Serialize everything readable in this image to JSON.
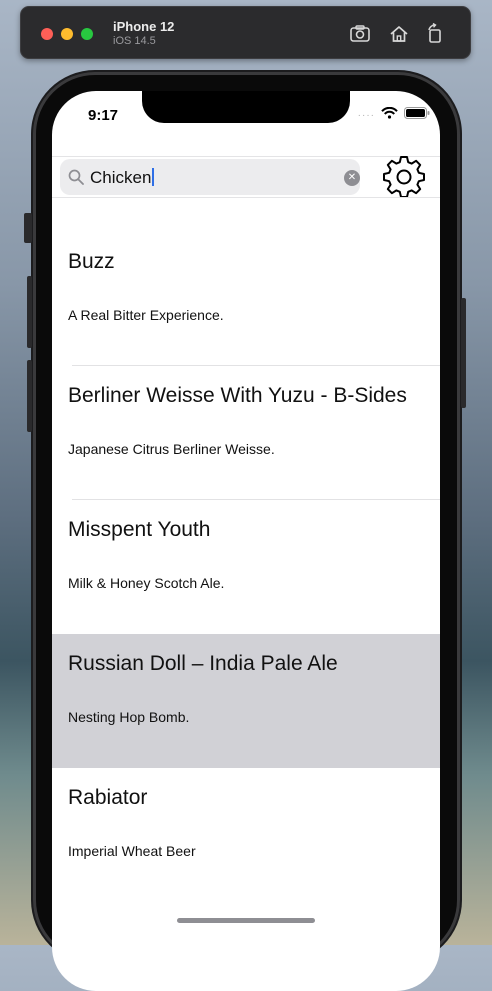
{
  "simulator": {
    "device_name": "iPhone 12",
    "os_version": "iOS 14.5",
    "screenshot_icon": "camera-icon",
    "home_icon": "home-icon",
    "rotate_icon": "rotate-icon"
  },
  "status_bar": {
    "time": "9:17",
    "signal_dots": "····"
  },
  "search": {
    "value": "Chicken",
    "clear_icon": "clear-circle-icon"
  },
  "settings": {
    "icon": "gear-icon"
  },
  "beers": [
    {
      "name": "Buzz",
      "tagline": "A Real Bitter Experience."
    },
    {
      "name": "Berliner Weisse With Yuzu - B-Sides",
      "tagline": "Japanese Citrus Berliner Weisse."
    },
    {
      "name": "Misspent Youth",
      "tagline": "Milk & Honey Scotch Ale."
    },
    {
      "name": "Russian Doll – India Pale Ale",
      "tagline": "Nesting Hop Bomb.",
      "selected": true
    },
    {
      "name": "Rabiator",
      "tagline": "Imperial Wheat Beer"
    }
  ],
  "colors": {
    "selected_row": "#d1d1d6",
    "search_field": "#ececee",
    "caret": "#2f6fe6"
  }
}
